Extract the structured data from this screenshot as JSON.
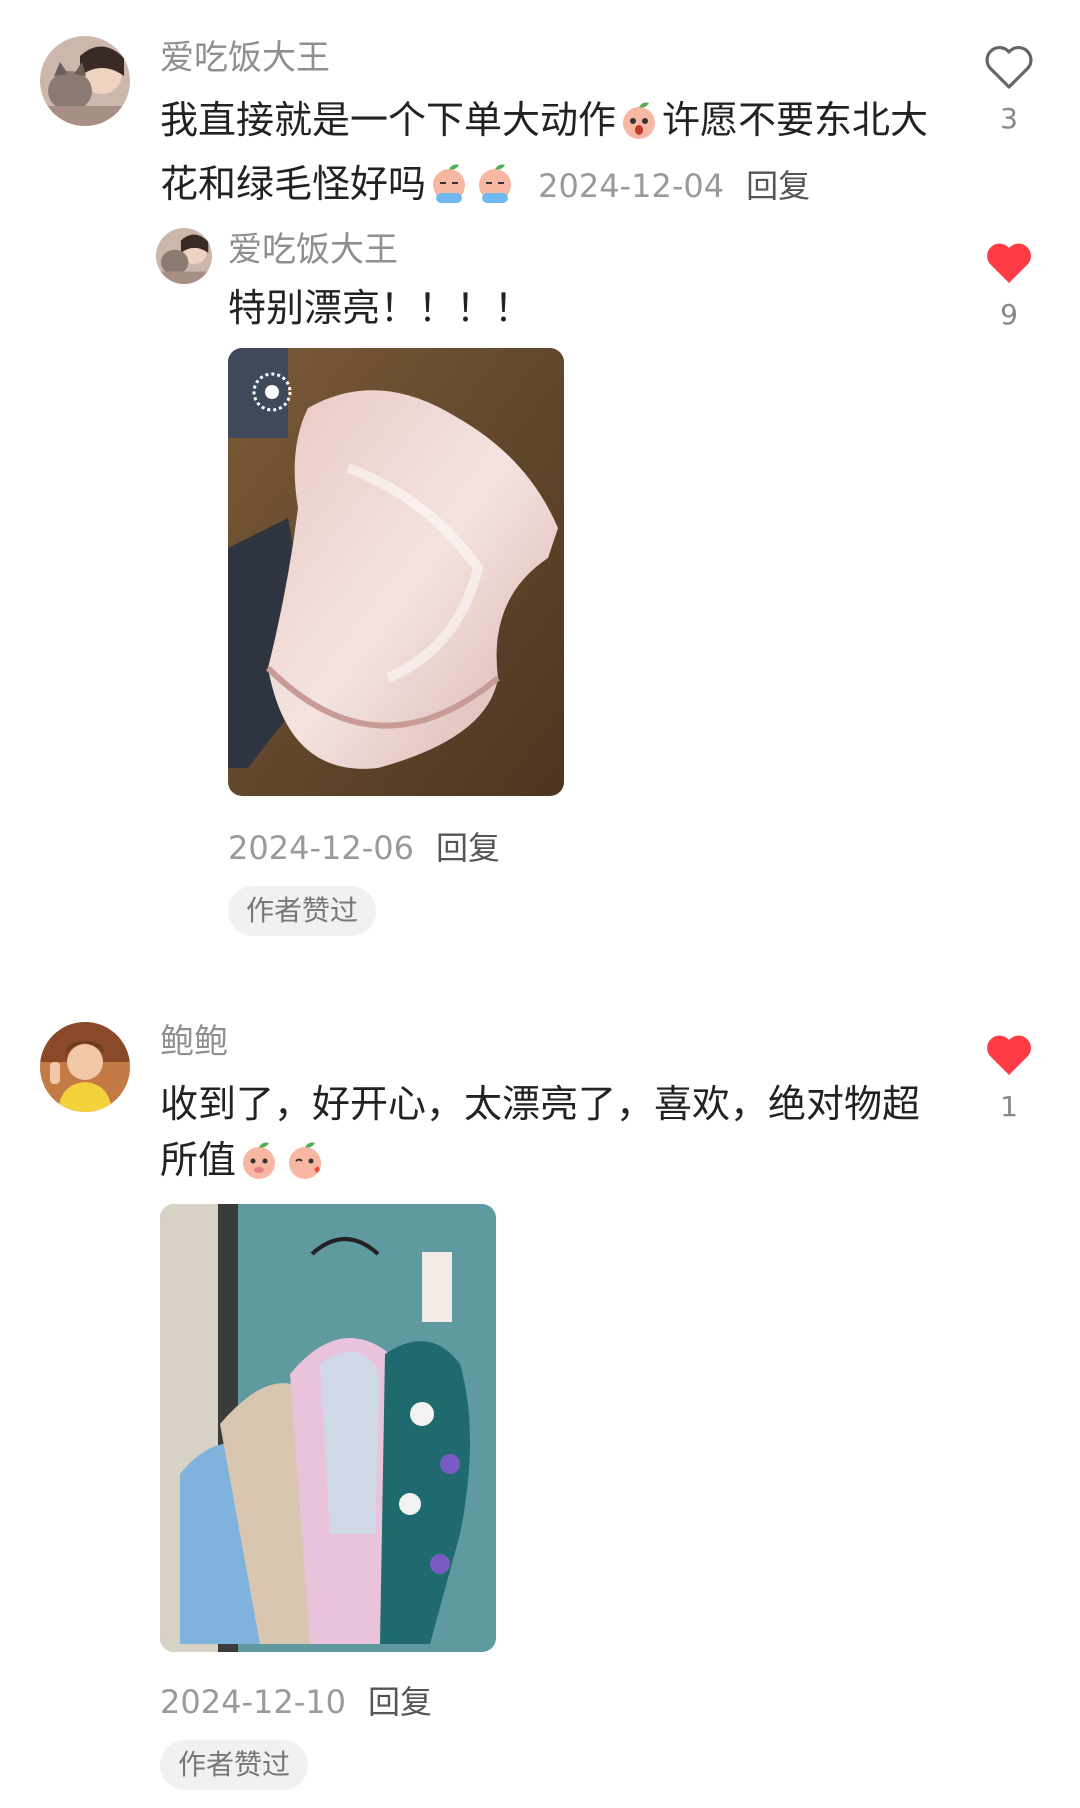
{
  "comments": [
    {
      "username": "爱吃饭大王",
      "text_before": "我直接就是一个下单大动作",
      "text_middle": "许愿不要东北大花和绿毛怪好吗",
      "date": "2024-12-04",
      "reply_label": "回复",
      "likes": "3",
      "liked": false,
      "replies": [
        {
          "username": "爱吃饭大王",
          "text": "特别漂亮！！！！",
          "date": "2024-12-06",
          "reply_label": "回复",
          "likes": "9",
          "liked": true,
          "author_badge": "作者赞过"
        }
      ]
    },
    {
      "username": "鲍鲍",
      "text_before": "收到了，好开心，太漂亮了，喜欢，绝对物超所值",
      "date": "2024-12-10",
      "reply_label": "回复",
      "likes": "1",
      "liked": true,
      "author_badge": "作者赞过"
    }
  ],
  "colors": {
    "like_red": "#ff3b46",
    "text": "#222222",
    "meta": "#9a9a9a"
  }
}
